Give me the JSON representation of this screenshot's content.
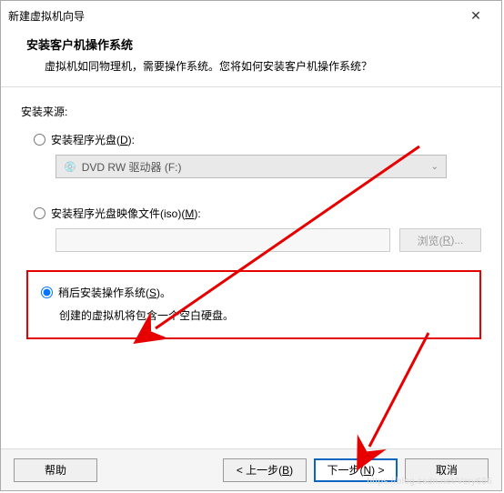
{
  "window": {
    "title": "新建虚拟机向导"
  },
  "header": {
    "title": "安装客户机操作系统",
    "subtitle": "虚拟机如同物理机，需要操作系统。您将如何安装客户机操作系统？"
  },
  "section": {
    "label": "安装来源:"
  },
  "option_disc": {
    "label_pre": "安装程序光盘(",
    "accel": "D",
    "label_post": "):",
    "dropdown_prefix": "DVD RW 驱动器 (F:)"
  },
  "option_iso": {
    "label_pre": "安装程序光盘映像文件(iso)(",
    "accel": "M",
    "label_post": "):",
    "browse_pre": "浏览(",
    "browse_accel": "R",
    "browse_post": ")..."
  },
  "option_later": {
    "label_pre": "稍后安装操作系统(",
    "accel": "S",
    "label_post": ")。",
    "description": "创建的虚拟机将包含一个空白硬盘。"
  },
  "footer": {
    "help": "帮助",
    "back_pre": "< 上一步(",
    "back_accel": "B",
    "back_post": ")",
    "next_pre": "下一步(",
    "next_accel": "N",
    "next_post": ") >",
    "cancel": "取消"
  },
  "watermark": "https://blog.csdn.net/Very666"
}
